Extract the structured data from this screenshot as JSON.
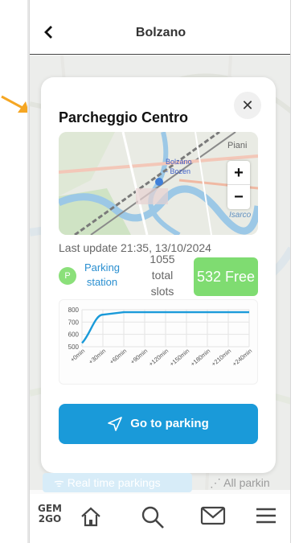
{
  "header": {
    "title": "Bolzano"
  },
  "popup": {
    "title": "Parcheggio Centro",
    "map_labels": {
      "label_bolzano": "Bolzano",
      "label_bozen": "- Bozen",
      "label_piani": "Piani",
      "label_isarco": "Isarco"
    },
    "last_update": "Last update 21:35, 13/10/2024",
    "station_marker": "P",
    "station_label_line1": "Parking",
    "station_label_line2": "station",
    "slots_count": "1055",
    "slots_line2": "total",
    "slots_line3": "slots",
    "free_label": "532 Free",
    "go_label": "Go to parking"
  },
  "chart_data": {
    "type": "line",
    "categories": [
      "+0min",
      "+30min",
      "+60min",
      "+90min",
      "+120min",
      "+150min",
      "+180min",
      "+210min",
      "+240min"
    ],
    "values": [
      530,
      760,
      780,
      780,
      780,
      780,
      780,
      780,
      780
    ],
    "y_ticks": [
      "800",
      "700",
      "600",
      "500"
    ],
    "ylim": [
      500,
      800
    ],
    "grid": true,
    "color": "#1a9ad9"
  },
  "tabs": {
    "realtime": "Real time parkings",
    "all": "All parkin"
  },
  "nav": {
    "logo_line1": "GEM",
    "logo_line2": "2GO"
  },
  "colors": {
    "accent": "#1a9ad9",
    "free": "#7fdc71",
    "arrow": "#f5a623"
  }
}
